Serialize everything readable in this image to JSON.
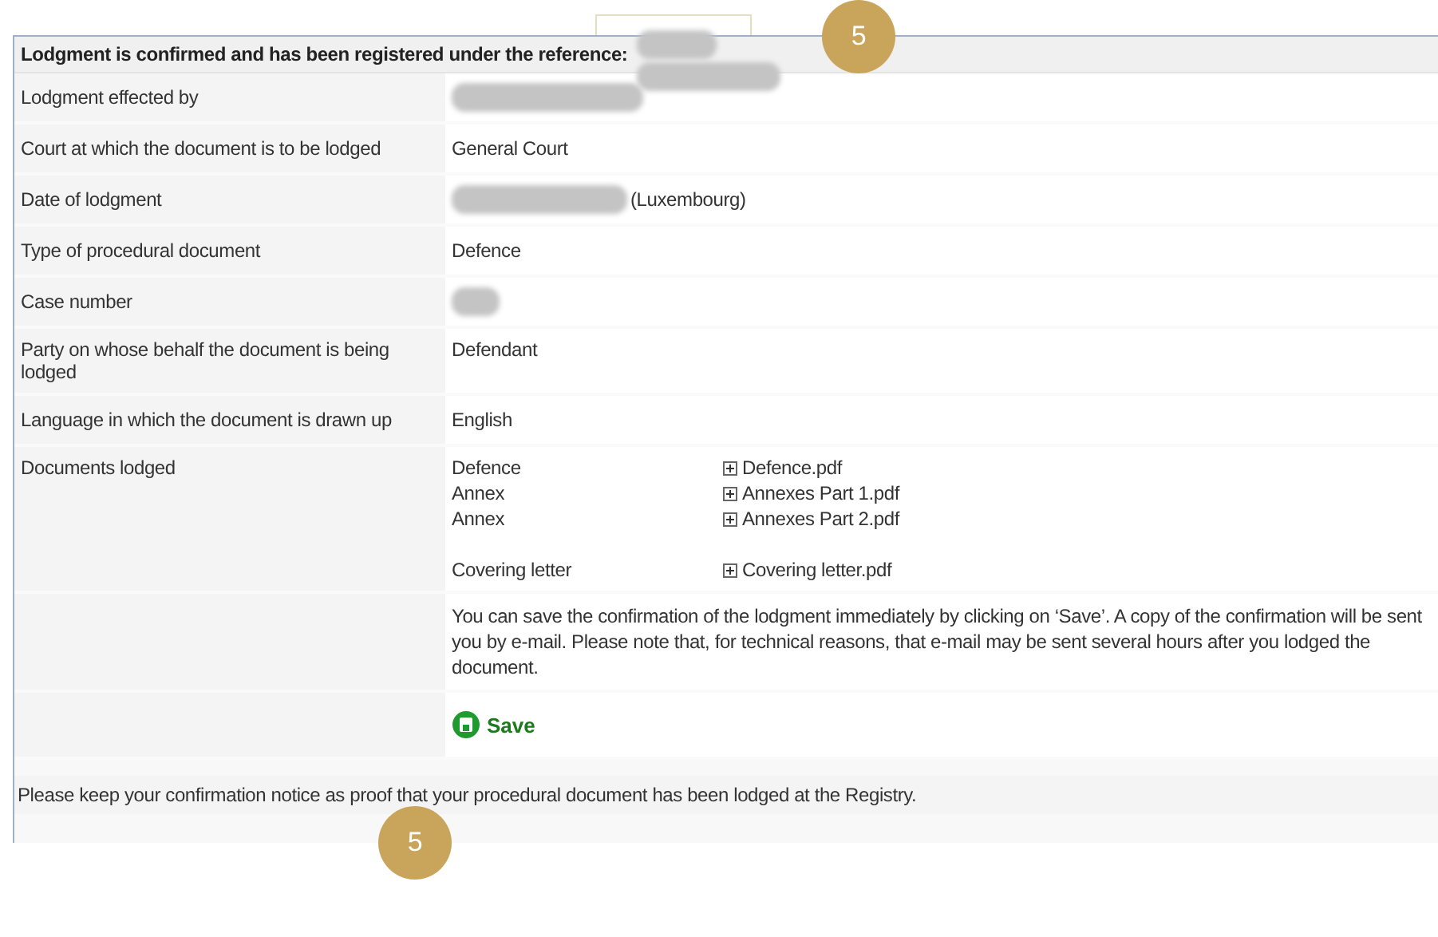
{
  "header": {
    "title": "Lodgment is confirmed and has been registered under the reference:",
    "reference_redacted": true
  },
  "rows": [
    {
      "label": "Lodgment effected by",
      "value": "",
      "redacted": true
    },
    {
      "label": "Court at which the document is to be lodged",
      "value": "General Court",
      "redacted": false
    },
    {
      "label": "Date of lodgment",
      "value": "(Luxembourg)",
      "redacted": true
    },
    {
      "label": "Type of procedural document",
      "value": "Defence",
      "redacted": false
    },
    {
      "label": "Case number",
      "value": "",
      "redacted": true
    },
    {
      "label": "Party on whose behalf the document is being lodged",
      "value": "Defendant",
      "redacted": false
    },
    {
      "label": "Language in which the document is drawn up",
      "value": "English",
      "redacted": false
    }
  ],
  "documents": {
    "label": "Documents lodged",
    "items": [
      {
        "type": "Defence",
        "file": "Defence.pdf",
        "separated": false
      },
      {
        "type": "Annex",
        "file": "Annexes Part 1.pdf",
        "separated": false
      },
      {
        "type": "Annex",
        "file": "Annexes Part 2.pdf",
        "separated": false
      },
      {
        "type": "Covering letter",
        "file": "Covering letter.pdf",
        "separated": true
      }
    ]
  },
  "message_lines": [
    "You can save the confirmation of the lodgment immediately by clicking on ‘Save’. A copy of the confirmation will be sent",
    "you by e-mail. Please note that, for technical reasons, that e-mail may be sent several hours after you lodged the",
    "document."
  ],
  "save_button": "Save",
  "footer": "Please keep your confirmation notice as proof that your procedural document has been lodged at the Registry.",
  "badges": [
    "5",
    "5"
  ]
}
